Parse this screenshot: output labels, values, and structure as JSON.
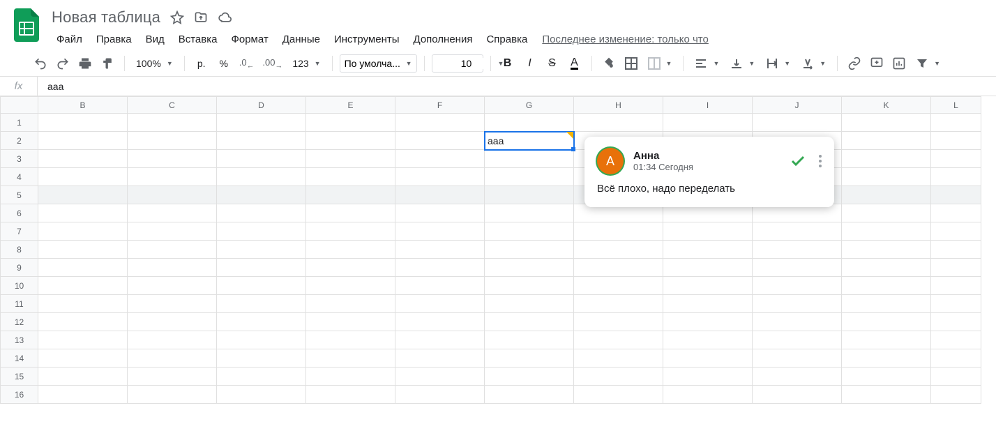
{
  "doc": {
    "title": "Новая таблица",
    "last_edit": "Последнее изменение: только что"
  },
  "menu": {
    "file": "Файл",
    "edit": "Правка",
    "view": "Вид",
    "insert": "Вставка",
    "format": "Формат",
    "data": "Данные",
    "tools": "Инструменты",
    "addons": "Дополнения",
    "help": "Справка"
  },
  "toolbar": {
    "zoom": "100%",
    "currency": "р.",
    "percent": "%",
    "dec_dec": ".0",
    "dec_inc": ".00",
    "num_fmt": "123",
    "font": "По умолча...",
    "font_size": "10",
    "bold": "B",
    "italic": "I",
    "strike": "S",
    "text_color": "A"
  },
  "formula_bar": {
    "fx": "fx",
    "value": "aaa"
  },
  "columns": [
    "B",
    "C",
    "D",
    "E",
    "F",
    "G",
    "H",
    "I",
    "J",
    "K",
    "L"
  ],
  "rows": [
    "1",
    "2",
    "3",
    "4",
    "5",
    "6",
    "7",
    "8",
    "9",
    "10",
    "11",
    "12",
    "13",
    "14",
    "15",
    "16"
  ],
  "active_cell": {
    "ref": "G2",
    "value": "aaa"
  },
  "comment": {
    "avatar_initial": "А",
    "author": "Анна",
    "timestamp": "01:34 Сегодня",
    "body": "Всё плохо, надо переделать"
  }
}
